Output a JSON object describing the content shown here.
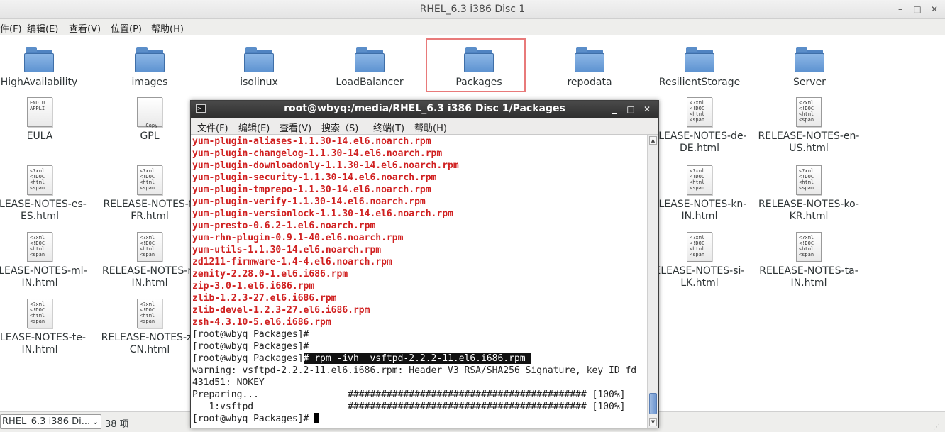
{
  "file_manager": {
    "title": "RHEL_6.3 i386 Disc 1",
    "menu": [
      "件(F)",
      "编辑(E)",
      "查看(V)",
      "位置(P)",
      "帮助(H)"
    ],
    "folders": [
      "HighAvailability",
      "images",
      "isolinux",
      "LoadBalancer",
      "Packages",
      "repodata",
      "ResilientStorage",
      "Server"
    ],
    "selected_folder": "Packages",
    "files": [
      {
        "label1": "EULA",
        "label2": "",
        "icon_text": "END U\nAPPLI"
      },
      {
        "label1": "GPL",
        "label2": "",
        "icon_text": "\n\n\n\n  Copy"
      },
      {
        "label1": "ELEASE-NOTES-de-",
        "label2": "DE.html",
        "icon_text": "<?xml\n<!DOC\n<html\n<span"
      },
      {
        "label1": "RELEASE-NOTES-en-",
        "label2": "US.html",
        "icon_text": "<?xml\n<!DOC\n<html\n<span"
      },
      {
        "label1": "ELEASE-NOTES-es-",
        "label2": "ES.html",
        "icon_text": "<?xml\n<!DOC\n<html\n<span"
      },
      {
        "label1": "RELEASE-NOTES-fr",
        "label2": "FR.html",
        "icon_text": "<?xml\n<!DOC\n<html\n<span"
      },
      {
        "label1": "ELEASE-NOTES-kn-",
        "label2": "IN.html",
        "icon_text": "<?xml\n<!DOC\n<html\n<span"
      },
      {
        "label1": "RELEASE-NOTES-ko-",
        "label2": "KR.html",
        "icon_text": "<?xml\n<!DOC\n<html\n<span"
      },
      {
        "label1": "ELEASE-NOTES-ml-",
        "label2": "IN.html",
        "icon_text": "<?xml\n<!DOC\n<html\n<span"
      },
      {
        "label1": "RELEASE-NOTES-m",
        "label2": "IN.html",
        "icon_text": "<?xml\n<!DOC\n<html\n<span"
      },
      {
        "label1": "ELEASE-NOTES-si-",
        "label2": "LK.html",
        "icon_text": "<?xml\n<!DOC\n<html\n<span"
      },
      {
        "label1": "RELEASE-NOTES-ta-",
        "label2": "IN.html",
        "icon_text": "<?xml\n<!DOC\n<html\n<span"
      },
      {
        "label1": "ELEASE-NOTES-te-",
        "label2": "IN.html",
        "icon_text": "<?xml\n<!DOC\n<html\n<span"
      },
      {
        "label1": "RELEASE-NOTES-zh",
        "label2": "CN.html",
        "icon_text": "<?xml\n<!DOC\n<html\n<span"
      }
    ],
    "status": {
      "location": "RHEL_6.3 i386 Di...",
      "count": "38 项"
    }
  },
  "terminal": {
    "title": "root@wbyq:/media/RHEL_6.3 i386 Disc 1/Packages",
    "menu": [
      "文件(F)",
      "编辑(E)",
      "查看(V)",
      "搜索（S)",
      "终端(T)",
      "帮助(H)"
    ],
    "rpm_lines": [
      "yum-plugin-aliases-1.1.30-14.el6.noarch.rpm",
      "yum-plugin-changelog-1.1.30-14.el6.noarch.rpm",
      "yum-plugin-downloadonly-1.1.30-14.el6.noarch.rpm",
      "yum-plugin-security-1.1.30-14.el6.noarch.rpm",
      "yum-plugin-tmprepo-1.1.30-14.el6.noarch.rpm",
      "yum-plugin-verify-1.1.30-14.el6.noarch.rpm",
      "yum-plugin-versionlock-1.1.30-14.el6.noarch.rpm",
      "yum-presto-0.6.2-1.el6.noarch.rpm",
      "yum-rhn-plugin-0.9.1-40.el6.noarch.rpm",
      "yum-utils-1.1.30-14.el6.noarch.rpm",
      "zd1211-firmware-1.4-4.el6.noarch.rpm",
      "zenity-2.28.0-1.el6.i686.rpm",
      "zip-3.0-1.el6.i686.rpm",
      "zlib-1.2.3-27.el6.i686.rpm",
      "zlib-devel-1.2.3-27.el6.i686.rpm",
      "zsh-4.3.10-5.el6.i686.rpm"
    ],
    "prompt": "[root@wbyq Packages]",
    "empty_prompt_1": "[root@wbyq Packages]#",
    "empty_prompt_2": "[root@wbyq Packages]#",
    "command": "# rpm -ivh  vsftpd-2.2.2-11.el6.i686.rpm ",
    "warning_1": "warning: vsftpd-2.2.2-11.el6.i686.rpm: Header V3 RSA/SHA256 Signature, key ID fd",
    "warning_2": "431d51: NOKEY",
    "preparing": "Preparing...                ########################################### [100%]",
    "install": "   1:vsftpd                 ########################################### [100%]",
    "final_prompt": "[root@wbyq Packages]# "
  }
}
